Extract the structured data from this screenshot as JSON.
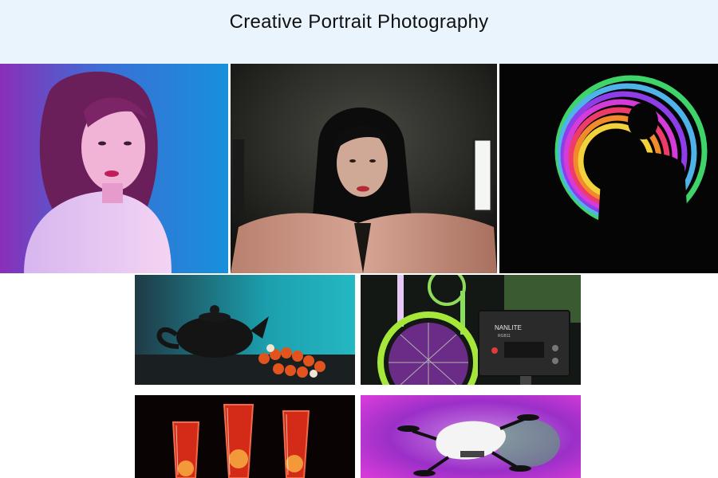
{
  "page": {
    "title": "Creative Portrait Photography"
  },
  "gallery": {
    "photos": [
      {
        "id": "portrait-neon",
        "subject": "woman with pink and blue neon lighting"
      },
      {
        "id": "portrait-led-panel",
        "subject": "woman lit by LED light panel in dark room"
      },
      {
        "id": "light-painting-silhouette",
        "subject": "silhouette with rainbow light painting"
      },
      {
        "id": "teapot-still-life",
        "subject": "black teapot with bead bracelet on teal smoke"
      },
      {
        "id": "bicycle-led-light",
        "subject": "bicycle wheel with LED video light"
      },
      {
        "id": "glasses-red-light",
        "subject": "drink glasses with orange slices in red light"
      },
      {
        "id": "drone-purple-smoke",
        "subject": "white drone in purple and green smoke"
      }
    ],
    "light_label_brand": "NANLITE",
    "light_label_model": "RGB11"
  },
  "colors": {
    "header_bg": "#e9f4fc",
    "accent_pink": "#d43bd8",
    "accent_blue": "#1a8fd8"
  }
}
